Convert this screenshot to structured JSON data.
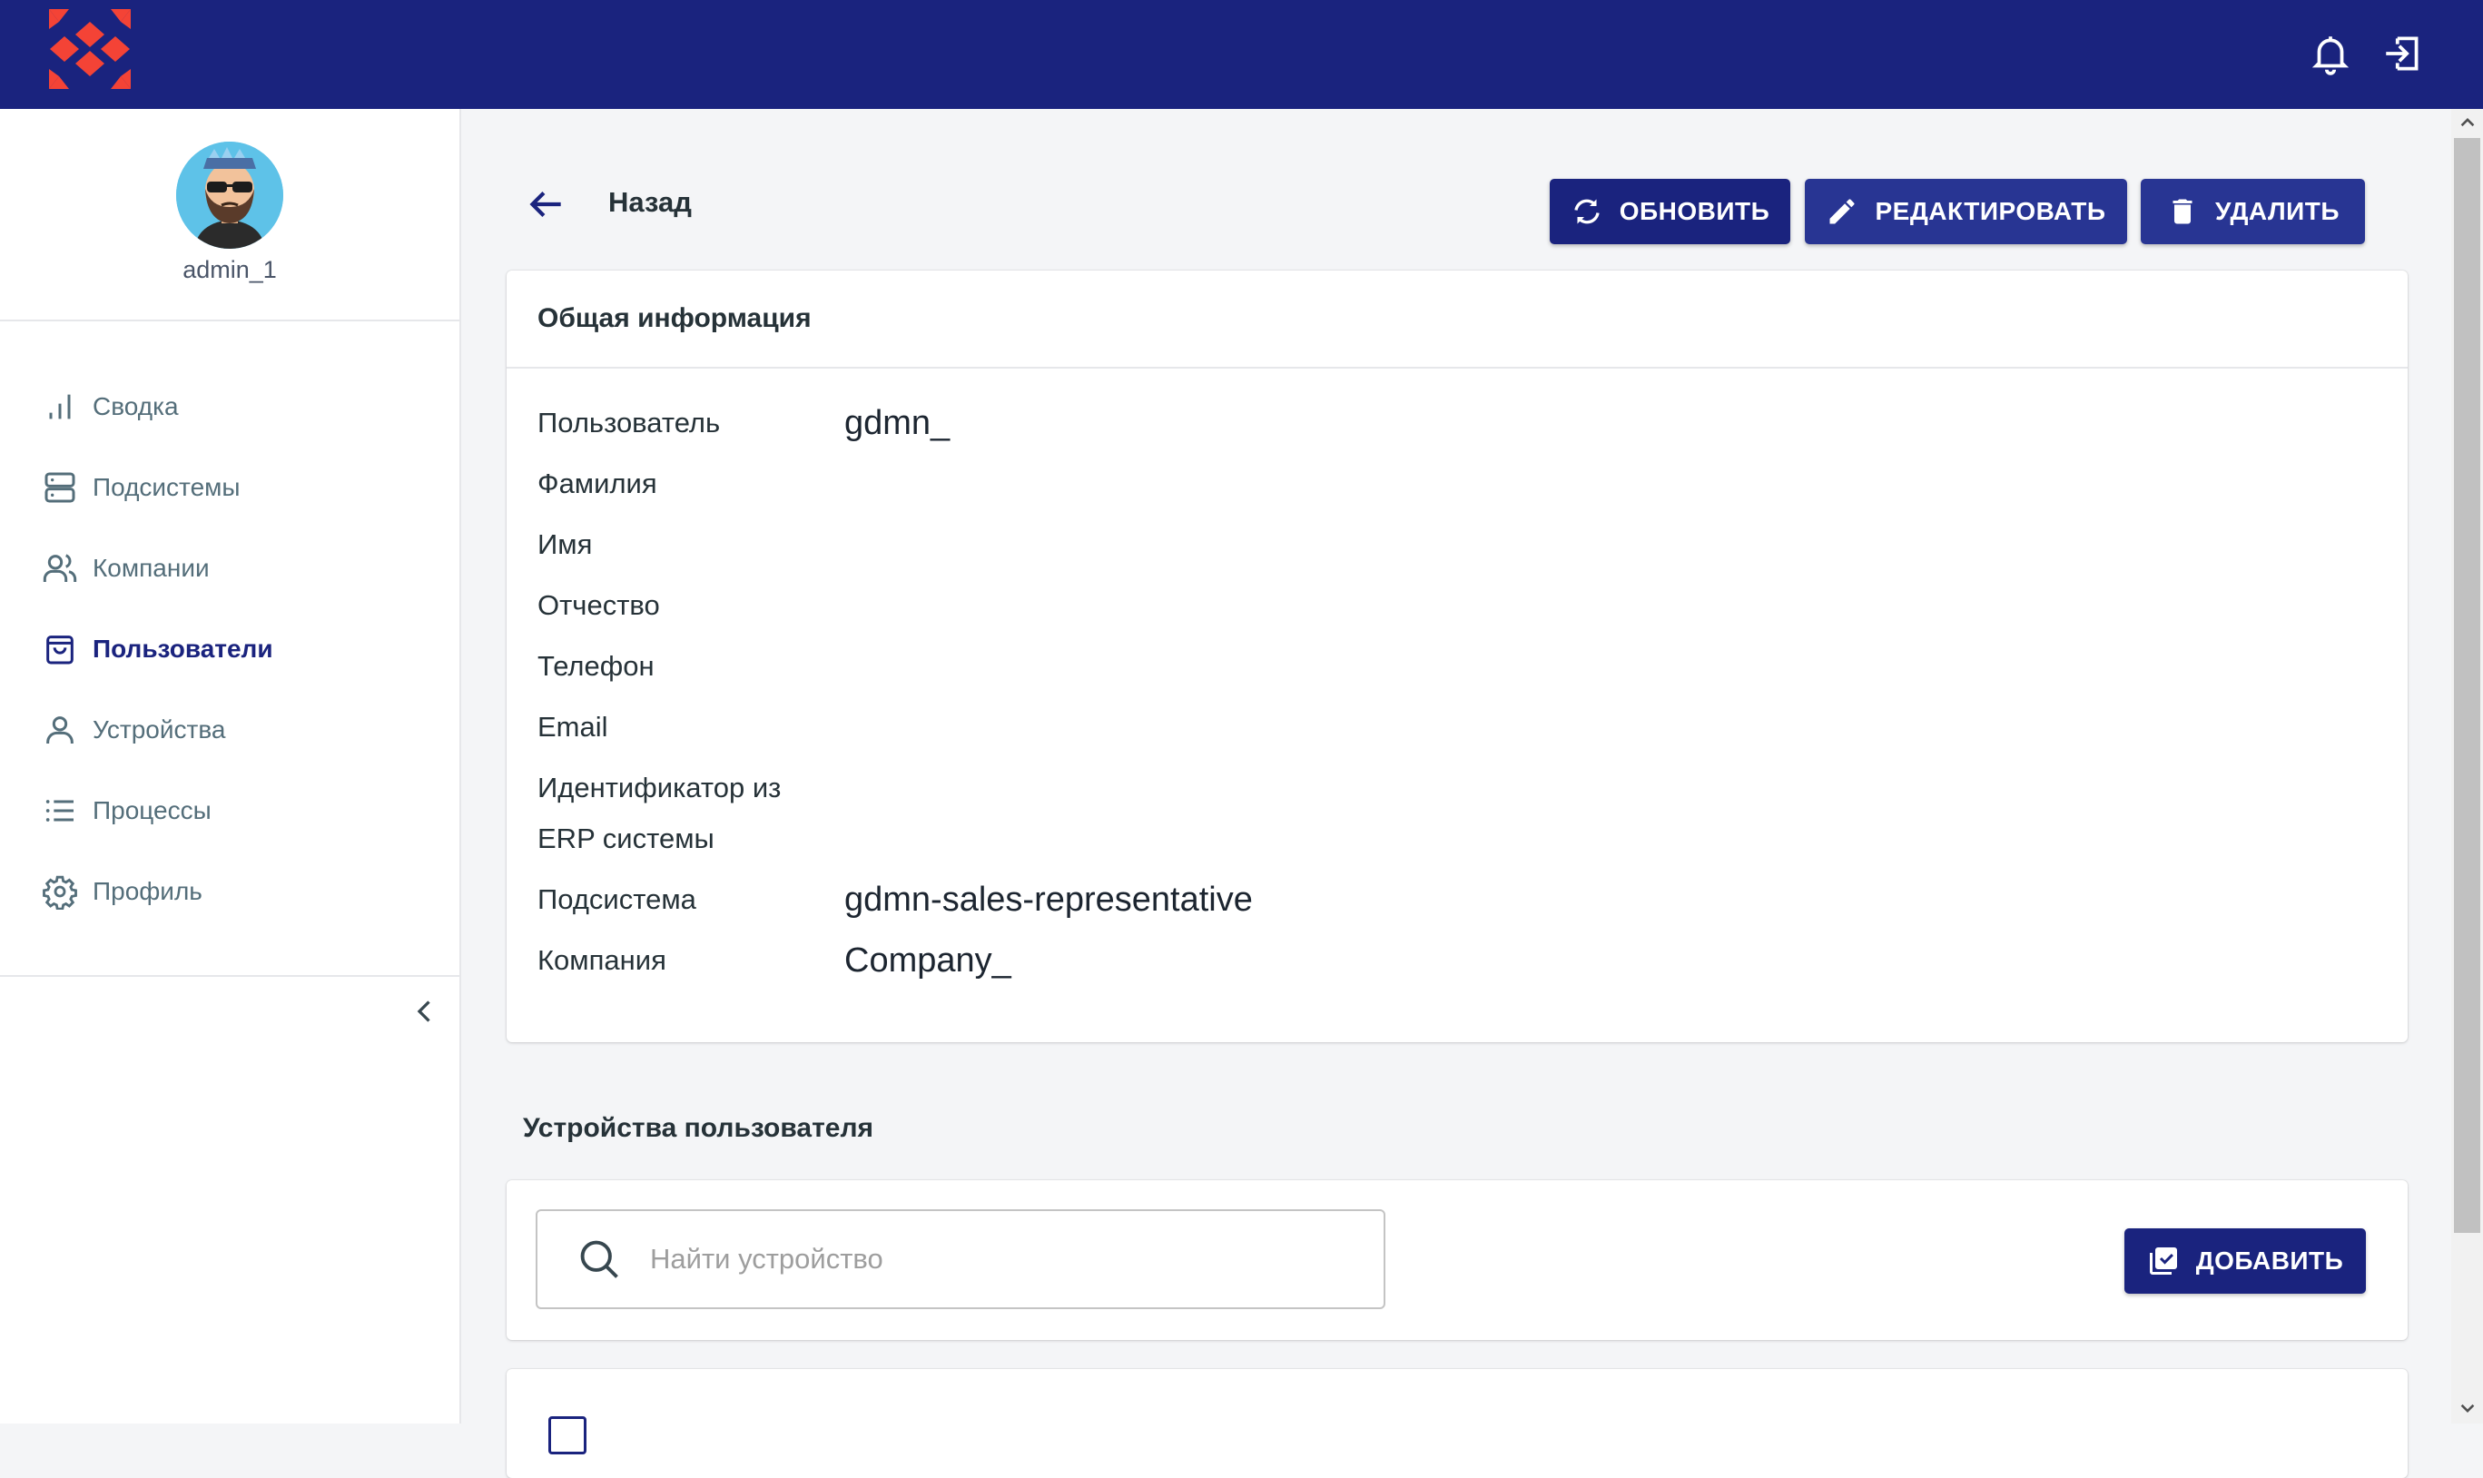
{
  "topbar": {
    "logo_icon": "brand-logo",
    "bell_icon": "bell-icon",
    "logout_icon": "logout-icon",
    "color": "#1a237e"
  },
  "sidebar": {
    "username": "admin_1",
    "items": [
      {
        "label": "Сводка",
        "icon": "bar-chart-icon",
        "active": false
      },
      {
        "label": "Подсистемы",
        "icon": "server-icon",
        "active": false
      },
      {
        "label": "Компании",
        "icon": "users-icon",
        "active": false
      },
      {
        "label": "Пользователи",
        "icon": "shopping-bag-icon",
        "active": true
      },
      {
        "label": "Устройства",
        "icon": "user-icon",
        "active": false
      },
      {
        "label": "Процессы",
        "icon": "list-icon",
        "active": false
      },
      {
        "label": "Профиль",
        "icon": "gear-icon",
        "active": false
      }
    ],
    "collapse_icon": "chevron-left-icon"
  },
  "header": {
    "back_label": "Назад",
    "refresh_label": "ОБНОВИТЬ",
    "edit_label": "РЕДАКТИРОВАТЬ",
    "delete_label": "УДАЛИТЬ"
  },
  "general": {
    "title": "Общая информация",
    "fields": [
      {
        "label": "Пользователь",
        "value": "gdmn_"
      },
      {
        "label": "Фамилия",
        "value": ""
      },
      {
        "label": "Имя",
        "value": ""
      },
      {
        "label": "Отчество",
        "value": ""
      },
      {
        "label": "Телефон",
        "value": ""
      },
      {
        "label": "Email",
        "value": ""
      },
      {
        "label": "Идентификатор из ERP системы",
        "value": ""
      },
      {
        "label": "Подсистема",
        "value": "gdmn-sales-representative"
      },
      {
        "label": "Компания",
        "value": "Company_"
      }
    ]
  },
  "devices": {
    "title": "Устройства пользователя",
    "search_placeholder": "Найти устройство",
    "add_label": "ДОБАВИТЬ"
  },
  "colors": {
    "accent": "#1a237e",
    "button_secondary": "#283593",
    "logo_red": "#f44336"
  }
}
